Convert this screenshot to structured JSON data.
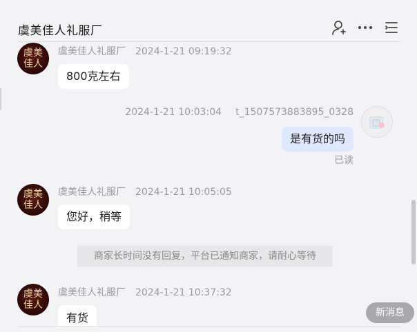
{
  "header": {
    "title": "虞美佳人礼服厂",
    "icons": [
      "user-plus-icon",
      "more-icon",
      "menu-icon"
    ]
  },
  "brand_avatar": {
    "line1": "虞美",
    "line2": "佳人"
  },
  "messages": [
    {
      "sender": "虞美佳人礼服厂",
      "time": "2024-1-21 09:19:32",
      "text": "800克左右"
    },
    {
      "sender": "t_1507573883895_0328",
      "time": "2024-1-21 10:03:04",
      "text": "是有货的吗",
      "status": "已读"
    },
    {
      "sender": "虞美佳人礼服厂",
      "time": "2024-1-21 10:05:05",
      "text": "您好，稍等"
    },
    {
      "sender": "虞美佳人礼服厂",
      "time": "2024-1-21 10:37:32",
      "text": "有货"
    }
  ],
  "system_notice": "商家长时间没有回复，平台已通知商家，请耐心等待",
  "new_message_button": "新消息",
  "colors": {
    "background": "#f3f3f6",
    "my_bubble": "#dfe8ff",
    "their_bubble": "#ffffff",
    "muted_text": "#9a9aa0"
  }
}
